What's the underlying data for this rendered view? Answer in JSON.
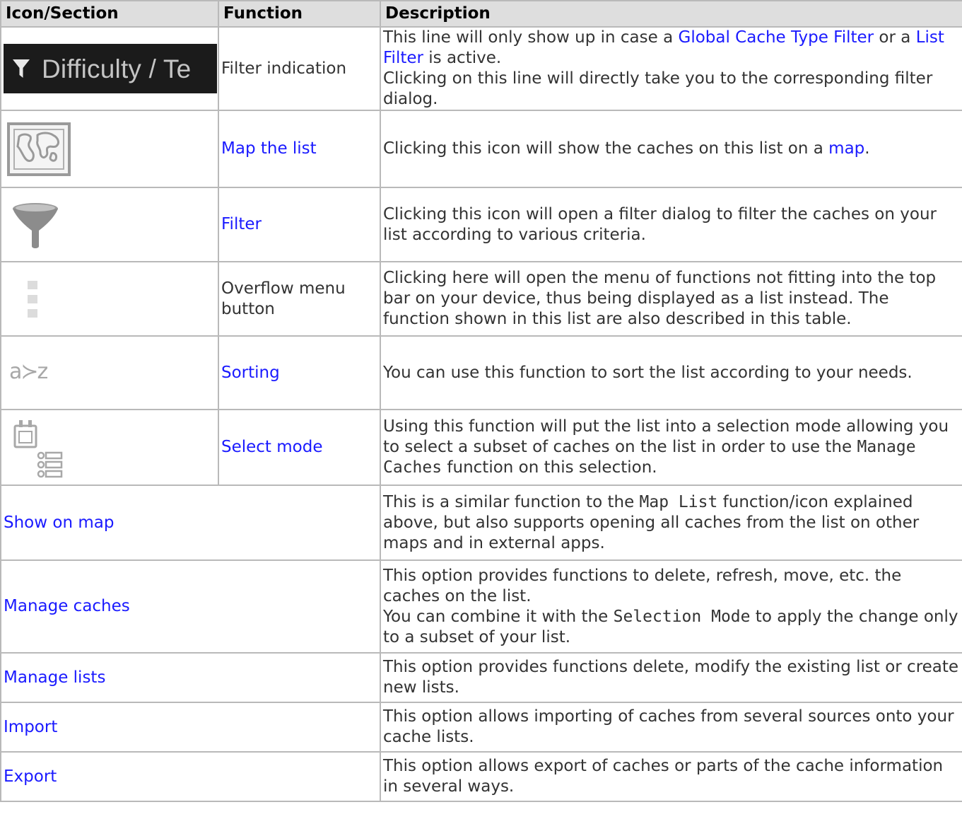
{
  "headers": [
    "Icon/Section",
    "Function",
    "Description"
  ],
  "rows": {
    "filter_indication": {
      "icon_text": "Difficulty / Te",
      "function": "Filter indication",
      "d1": "This line will only show up in case a ",
      "link1": "Global Cache Type Filter",
      "d2": " or a ",
      "link2": "List Filter",
      "d3": " is active.",
      "d4": "Clicking on this line will directly take you to the corresponding filter dialog."
    },
    "map_list": {
      "icon": "map-icon",
      "function": "Map the list",
      "d1": "Clicking this icon will show the caches on this list on a ",
      "link1": "map",
      "d2": "."
    },
    "filter": {
      "icon": "funnel-icon",
      "function": "Filter",
      "d1": "Clicking this icon will open a filter dialog to filter the caches on your list according to various criteria."
    },
    "overflow": {
      "icon": "overflow-menu-icon",
      "function": "Overflow menu button",
      "d1": "Clicking here will open the menu of functions not fitting into the top bar on your device, thus being displayed as a list instead. The function shown in this list are also described in this table."
    },
    "sorting": {
      "icon": "sort-az-icon",
      "icon_text": "a≻z",
      "function": "Sorting",
      "d1": "You can use this function to sort the list according to your needs."
    },
    "select_mode": {
      "icon": "select-mode-icon",
      "function": "Select mode",
      "d1": "Using this function will put the list into a selection mode allowing you to select a subset of caches on the list in order to use the ",
      "code1": "Manage Caches",
      "d2": " function on this selection."
    },
    "show_on_map": {
      "section": "Show on map",
      "d1": "This is a similar function to the ",
      "code1": "Map List",
      "d2": " function/icon explained above, but also supports opening all caches from the list on other maps and in external apps."
    },
    "manage_caches": {
      "section": "Manage caches",
      "d1": "This option provides functions to delete, refresh, move, etc. the caches on the list.",
      "d2": "You can combine it with the ",
      "code1": "Selection Mode",
      "d3": " to apply the change only to a subset of your list."
    },
    "manage_lists": {
      "section": "Manage lists",
      "d1": "This option provides functions delete, modify the existing list or create new lists."
    },
    "import": {
      "section": "Import",
      "d1": "This option allows importing of caches from several sources onto your cache lists."
    },
    "export": {
      "section": "Export",
      "d1": "This option allows export of caches or parts of the cache information in several ways."
    }
  },
  "colors": {
    "link": "#1a1aff",
    "header_bg": "#dedede",
    "border": "#b9b9b9",
    "filter_bar_bg": "#1b1b1b"
  }
}
